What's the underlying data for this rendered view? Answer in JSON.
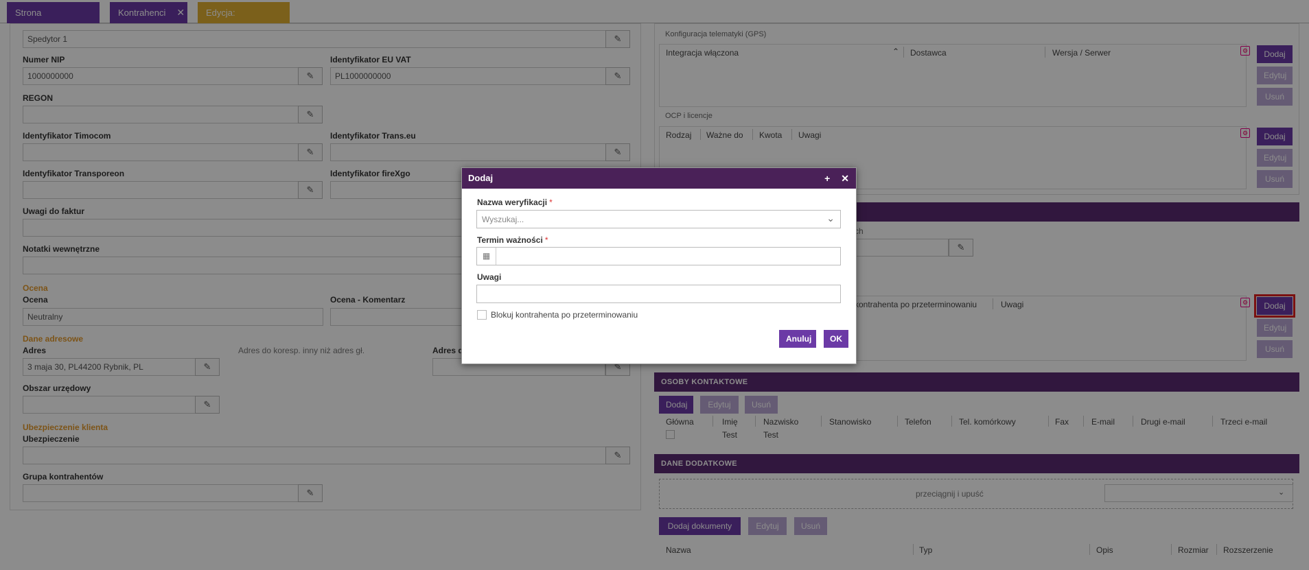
{
  "tabs": [
    {
      "label": "Strona startowa"
    },
    {
      "label": "Kontrahenci"
    },
    {
      "label": "Edycja: fireTMS"
    }
  ],
  "left_form": {
    "spedytor_value": "Spedytor 1",
    "nip_label": "Numer NIP",
    "nip_value": "1000000000",
    "euvat_label": "Identyfikator EU VAT",
    "euvat_value": "PL1000000000",
    "regon_label": "REGON",
    "timocom_label": "Identyfikator Timocom",
    "transeu_label": "Identyfikator Trans.eu",
    "transporeon_label": "Identyfikator Transporeon",
    "firexgo_label": "Identyfikator fireXgo",
    "uwagi_faktur_label": "Uwagi do faktur",
    "notatki_label": "Notatki wewnętrzne",
    "ocena_section": "Ocena",
    "ocena_label": "Ocena",
    "ocena_value": "Neutralny",
    "ocena_komentarz_label": "Ocena - Komentarz",
    "dane_adresowe_section": "Dane adresowe",
    "adres_label": "Adres",
    "adres_value": "3 maja 30, PL44200 Rybnik, PL",
    "adres_hint": "Adres do koresp. inny niż adres gł.",
    "adres_d_label": "Adres d",
    "obszar_label": "Obszar urzędowy",
    "ubezpieczenie_section": "Ubezpieczenie klienta",
    "ubezpieczenie_label": "Ubezpieczenie",
    "grupa_label": "Grupa kontrahentów"
  },
  "right_panel": {
    "gps_title": "Konfiguracja telematyki (GPS)",
    "gps_columns": [
      "Integracja włączona",
      "Dostawca",
      "Wersja / Serwer"
    ],
    "ocp_title": "OCP i licencje",
    "ocp_columns": [
      "Rodzaj",
      "Ważne do",
      "Kwota",
      "Uwagi"
    ],
    "verif_partial_label": "ch",
    "verif_columns": [
      "kontrahenta po przeterminowaniu",
      "Uwagi"
    ],
    "btn_dodaj": "Dodaj",
    "btn_edytuj": "Edytuj",
    "btn_usun": "Usuń",
    "osoby_title": "OSOBY KONTAKTOWE",
    "osoby_columns": [
      "Główna",
      "Imię",
      "Nazwisko",
      "Stanowisko",
      "Telefon",
      "Tel. komórkowy",
      "Fax",
      "E-mail",
      "Drugi e-mail",
      "Trzeci e-mail"
    ],
    "osoby_row": {
      "imie": "Test",
      "nazwisko": "Test"
    },
    "dane_dodatkowe_title": "DANE DODATKOWE",
    "dropzone_text": "przeciągnij i upuść",
    "btn_dodaj_dokumenty": "Dodaj dokumenty",
    "doc_columns": [
      "Nazwa",
      "Typ",
      "Opis",
      "Rozmiar",
      "Rozszerzenie"
    ]
  },
  "modal": {
    "title": "Dodaj",
    "nazwa_label": "Nazwa weryfikacji",
    "nazwa_placeholder": "Wyszukaj...",
    "termin_label": "Termin ważności",
    "uwagi_label": "Uwagi",
    "checkbox_label": "Blokuj kontrahenta po przeterminowaniu",
    "required_mark": "*",
    "cancel_label": "Anuluj",
    "ok_label": "OK"
  },
  "colors": {
    "accent": "#6b3aa6",
    "header_dark": "#4a2158",
    "section_orange": "#e39a2c",
    "highlight_red": "#e02020"
  }
}
